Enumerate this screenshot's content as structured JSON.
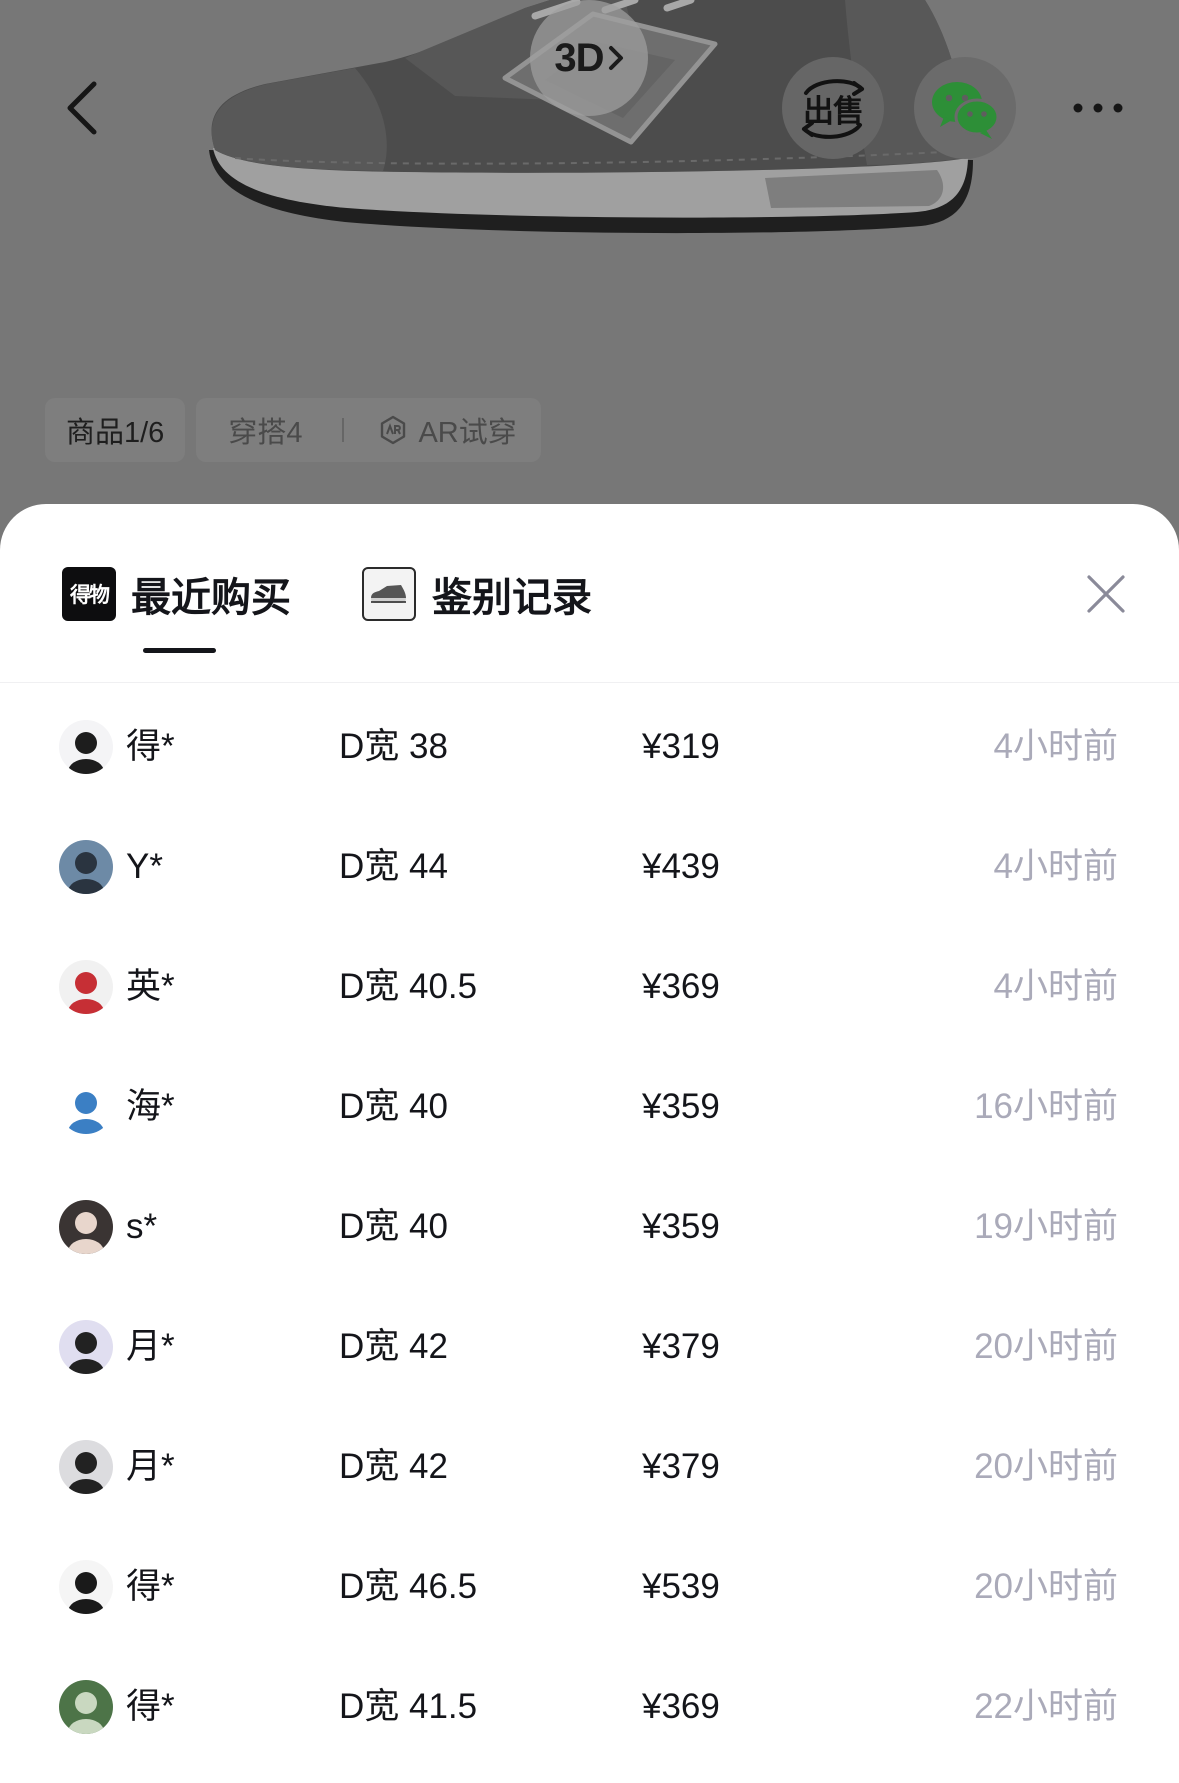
{
  "header": {
    "back_icon": "chevron-left-icon",
    "view_3d": {
      "label": "3D",
      "icon": "chevron-right-icon"
    },
    "sell": {
      "label": "出售",
      "icon": "sell-cycle-icon"
    },
    "share_icon": "wechat-icon",
    "more_icon": "more-icon"
  },
  "media_tabs": [
    {
      "label": "商品1/6",
      "active": true
    },
    {
      "label": "穿搭4",
      "active": false
    },
    {
      "label": "AR试穿",
      "icon": "ar-icon",
      "active": false
    }
  ],
  "sheet": {
    "tabs": [
      {
        "label": "最近购买",
        "logo_text": "得物",
        "active": true
      },
      {
        "label": "鉴别记录",
        "thumbnail_icon": "sneaker-thumbnail-icon",
        "active": false
      }
    ],
    "close_icon": "close-icon"
  },
  "colors": {
    "primary_text": "#14151a",
    "secondary_text": "#aaaab9",
    "overlay": "#777777",
    "wechat_green": "#2d8f37"
  },
  "purchases": [
    {
      "name": "得*",
      "spec": "D宽 38",
      "price": "¥319",
      "time": "4小时前",
      "avatar_color": "#f4f4f6",
      "avatar_accent": "#1d1d1d"
    },
    {
      "name": "Y*",
      "spec": "D宽 44",
      "price": "¥439",
      "time": "4小时前",
      "avatar_color": "#6d8aa6",
      "avatar_accent": "#2a3440"
    },
    {
      "name": "英*",
      "spec": "D宽 40.5",
      "price": "¥369",
      "time": "4小时前",
      "avatar_color": "#f1f1f1",
      "avatar_accent": "#c62f35"
    },
    {
      "name": "海*",
      "spec": "D宽 40",
      "price": "¥359",
      "time": "16小时前",
      "avatar_color": "#ffffff",
      "avatar_accent": "#3b7fc4"
    },
    {
      "name": "s*",
      "spec": "D宽 40",
      "price": "¥359",
      "time": "19小时前",
      "avatar_color": "#3a3433",
      "avatar_accent": "#e8d6cc"
    },
    {
      "name": "月*",
      "spec": "D宽 42",
      "price": "¥379",
      "time": "20小时前",
      "avatar_color": "#e0def0",
      "avatar_accent": "#222222"
    },
    {
      "name": "月*",
      "spec": "D宽 42",
      "price": "¥379",
      "time": "20小时前",
      "avatar_color": "#dcdcdf",
      "avatar_accent": "#222222"
    },
    {
      "name": "得*",
      "spec": "D宽 46.5",
      "price": "¥539",
      "time": "20小时前",
      "avatar_color": "#f5f5f5",
      "avatar_accent": "#1a1a1a"
    },
    {
      "name": "得*",
      "spec": "D宽 41.5",
      "price": "¥369",
      "time": "22小时前",
      "avatar_color": "#4d7448",
      "avatar_accent": "#c9d8c0"
    }
  ]
}
